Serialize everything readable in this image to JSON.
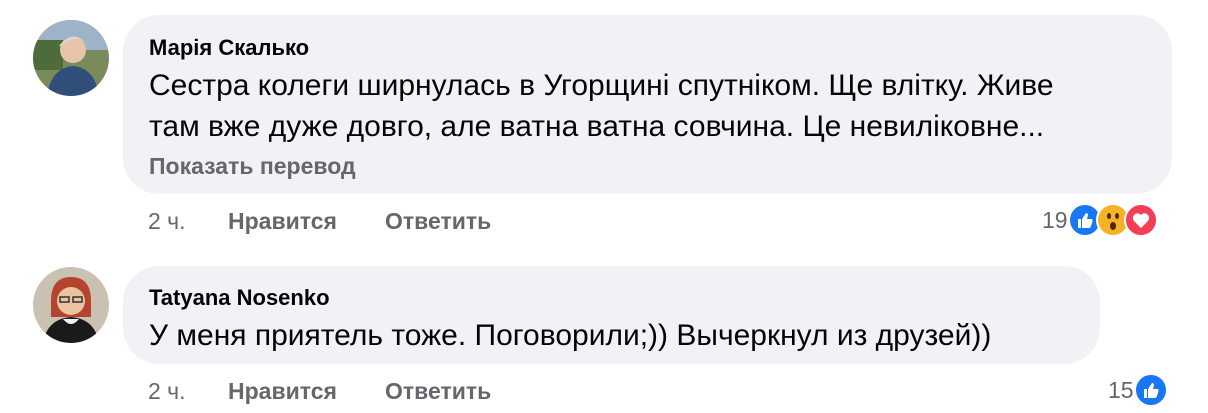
{
  "comments": [
    {
      "author": "Марія Скалько",
      "text_line1": "Сестра колеги ширнулась в Угорщині спутніком. Ще влітку. Живе",
      "text_line2": "там вже дуже довго, але ватна ватна совчина. Це невиліковне...",
      "translate": "Показать перевод",
      "time": "2 ч.",
      "like": "Нравится",
      "reply": "Ответить",
      "reactions_count": "19",
      "reactions": [
        "like-icon",
        "wow-icon",
        "love-icon"
      ]
    },
    {
      "author": "Tatyana Nosenko",
      "text_line1": "У меня приятель тоже. Поговорили;)) Вычеркнул из друзей))",
      "time": "2 ч.",
      "like": "Нравится",
      "reply": "Ответить",
      "reactions_count": "15",
      "reactions": [
        "like-icon"
      ]
    }
  ],
  "colors": {
    "bubble": "#f0f2f5",
    "secondary_text": "#65676b",
    "like_blue": "#1877f2",
    "love_red": "#f33e58",
    "wow_yellow": "#f7b125"
  }
}
